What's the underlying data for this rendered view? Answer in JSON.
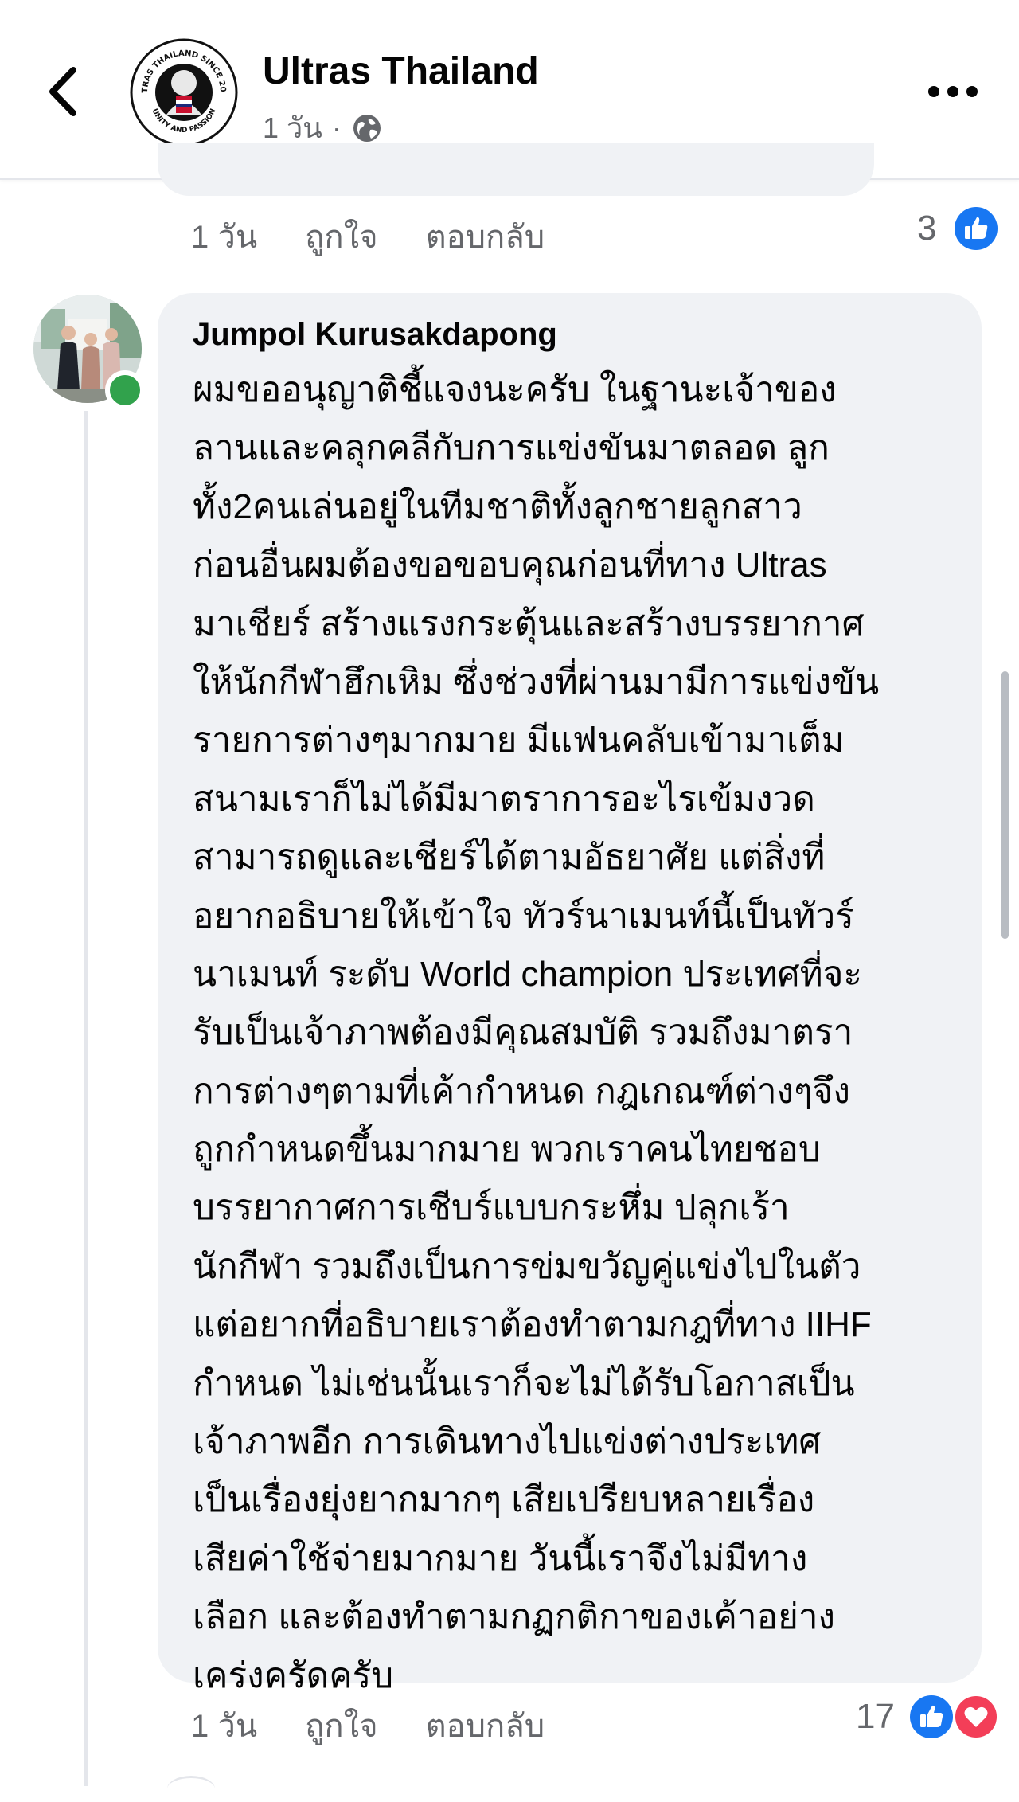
{
  "header": {
    "page_name": "Ultras Thailand",
    "time": "1 วัน",
    "separator": "·",
    "logo_text_top": "ULTRAS THAILAND SINCE 2012",
    "logo_text_bottom": "UNITY AND PASSION",
    "icons": [
      "back-arrow-icon",
      "globe-icon",
      "more-icon"
    ]
  },
  "prev_comment": {
    "actions": {
      "time": "1 วัน",
      "like": "ถูกใจ",
      "reply": "ตอบกลับ"
    },
    "reaction_count": "3",
    "reactions": [
      "like"
    ]
  },
  "comment": {
    "author": "Jumpol Kurusakdapong",
    "online": true,
    "lines": [
      "ผมขออนุญาติชี้แจงนะครับ ในฐานะเจ้าของ",
      "ลานและคลุกคลีกับการแข่งขันมาตลอด  ลูก",
      "ทั้ง2คนเล่นอยู่ในทีมชาติทั้งลูกชายลูกสาว",
      "ก่อนอื่นผมต้องขอขอบคุณก่อนที่ทาง Ultras",
      "มาเชียร์ สร้างแรงกระตุ้นและสร้างบรรยากาศ",
      "ให้นักกีฬาฮึกเหิม ซึ่งช่วงที่ผ่านมามีการแข่งขัน",
      "รายการต่างๆมากมาย มีแฟนคลับเข้ามาเต็ม",
      "สนามเราก็ไม่ได้มีมาตราการอะไรเข้มงวด",
      "สามารถดูและเชียร์ได้ตามอัธยาศัย  แต่สิ่งที่",
      "อยากอธิบายให้เข้าใจ ทัวร์นาเมนท์นี้เป็นทัวร์",
      "นาเมนท์ ระดับ World champion ประเทศที่จะ",
      "รับเป็นเจ้าภาพต้องมีคุณสมบัติ รวมถึงมาตรา",
      "การต่างๆตามที่เค้ากำหนด กฎเกณฑ์ต่างๆจึง",
      "ถูกกำหนดขึ้นมากมาย พวกเราคนไทยชอบ",
      "บรรยากาศการเชีบร์แบบกระหึ่ม ปลุกเร้า",
      "นักกีฬา รวมถึงเป็นการข่มขวัญคู่แข่งไปในตัว",
      "แต่อยากที่อธิบายเราต้องทำตามกฎที่ทาง IIHF",
      "กำหนด ไม่เช่นนั้นเราก็จะไม่ได้รับโอกาสเป็น",
      "เจ้าภาพอีก  การเดินทางไปแข่งต่างประเทศ",
      "เป็นเรื่องยุ่งยากมากๆ เสียเปรียบหลายเรื่อง",
      "เสียค่าใช้จ่ายมากมาย  วันนี้เราจึงไม่มีทาง",
      "เลือก และต้องทำตามกฏกติกาของเค้าอย่าง",
      "เคร่งครัดครับ"
    ],
    "actions": {
      "time": "1 วัน",
      "like": "ถูกใจ",
      "reply": "ตอบกลับ"
    },
    "reaction_count": "17",
    "reactions": [
      "like",
      "love"
    ]
  },
  "colors": {
    "bubble": "#f0f2f5",
    "secondary_text": "#65676b",
    "like_blue": "#1877f2",
    "love_red": "#f33e58",
    "online_green": "#31a24c"
  }
}
